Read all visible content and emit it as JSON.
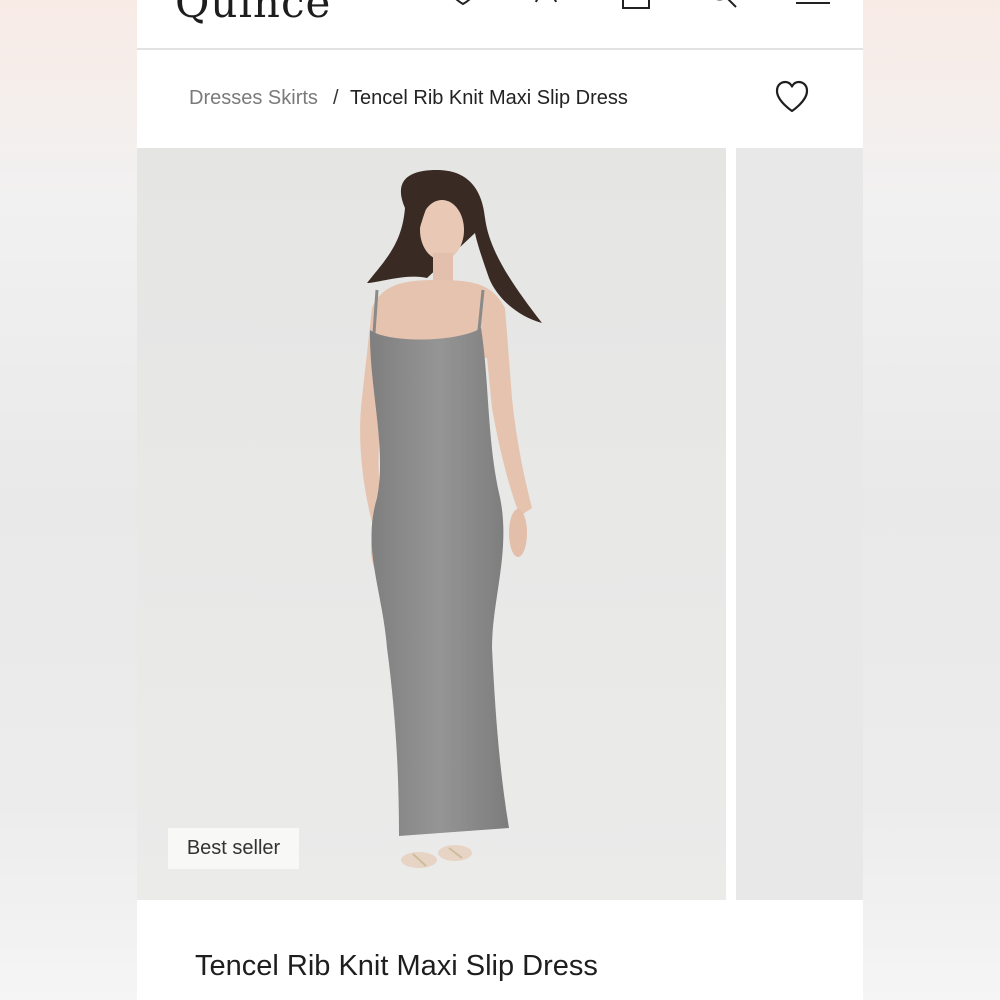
{
  "header": {
    "logo_text": "Quince",
    "icons": [
      "heart-icon",
      "account-icon",
      "bag-icon",
      "search-icon",
      "menu-icon"
    ]
  },
  "breadcrumb": {
    "parent": "Dresses Skirts",
    "separator": "/",
    "current": "Tencel Rib Knit Maxi Slip Dress"
  },
  "gallery": {
    "badge": "Best seller",
    "image_alt": "model wearing gray rib knit maxi slip dress"
  },
  "product": {
    "title": "Tencel Rib Knit Maxi Slip Dress"
  },
  "colors": {
    "dress": "#8d8d8d",
    "background": "#e8e8e7"
  }
}
